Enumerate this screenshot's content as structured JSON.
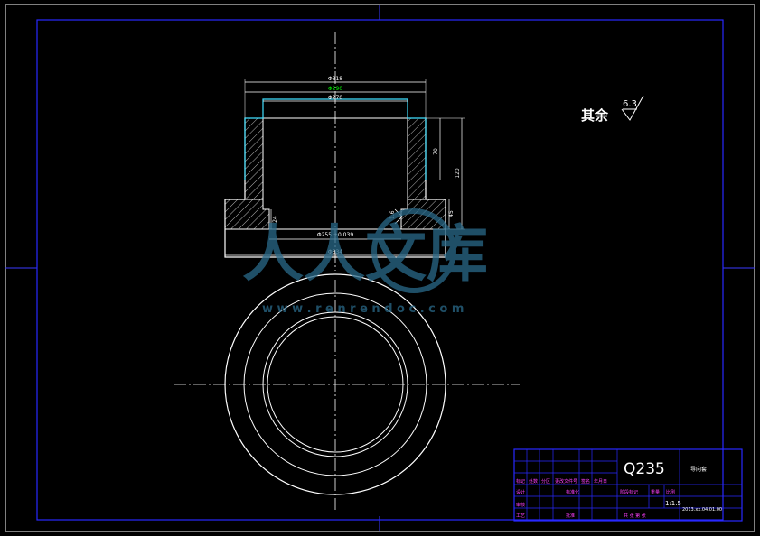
{
  "drawing": {
    "roughness_note": {
      "text": "其余",
      "value": "6.3"
    },
    "dimensions": {
      "top_outer": "Φ318",
      "top_inner_green": "Φ290",
      "bore": "Φ270",
      "height_right_inner": "70",
      "height_right_total": "120",
      "height_right_flange": "45",
      "left_flange": "24",
      "bottom_bore": "Φ255 +0.039",
      "bottom_base": "Φ334",
      "roughness_local": "1.6"
    },
    "watermark": {
      "brand": "人人文库",
      "url": "w w w . r e n r e n d o c . c o m"
    }
  },
  "title_block": {
    "material": "Q235",
    "part_name": "导向套",
    "scale": "1:1.5",
    "date": "2013.xx.04.01.00",
    "row_labels": [
      "标记",
      "处数",
      "分区",
      "更改文件号",
      "签名",
      "年月日"
    ],
    "designer": "设计",
    "standard": "标准化",
    "stage_label": "阶段标记",
    "weight_label": "重量",
    "scale_label": "比例",
    "reviewer": "审核",
    "process": "工艺",
    "approve": "批准",
    "sheets": "共 张 第 张"
  },
  "colors": {
    "background": "#000000",
    "frame": "#1a1aff",
    "geometry": "#ffffff",
    "cyan": "#40e0ff",
    "green": "#00ff00",
    "magenta": "#ff40ff",
    "watermark": "#2a6a8a"
  }
}
